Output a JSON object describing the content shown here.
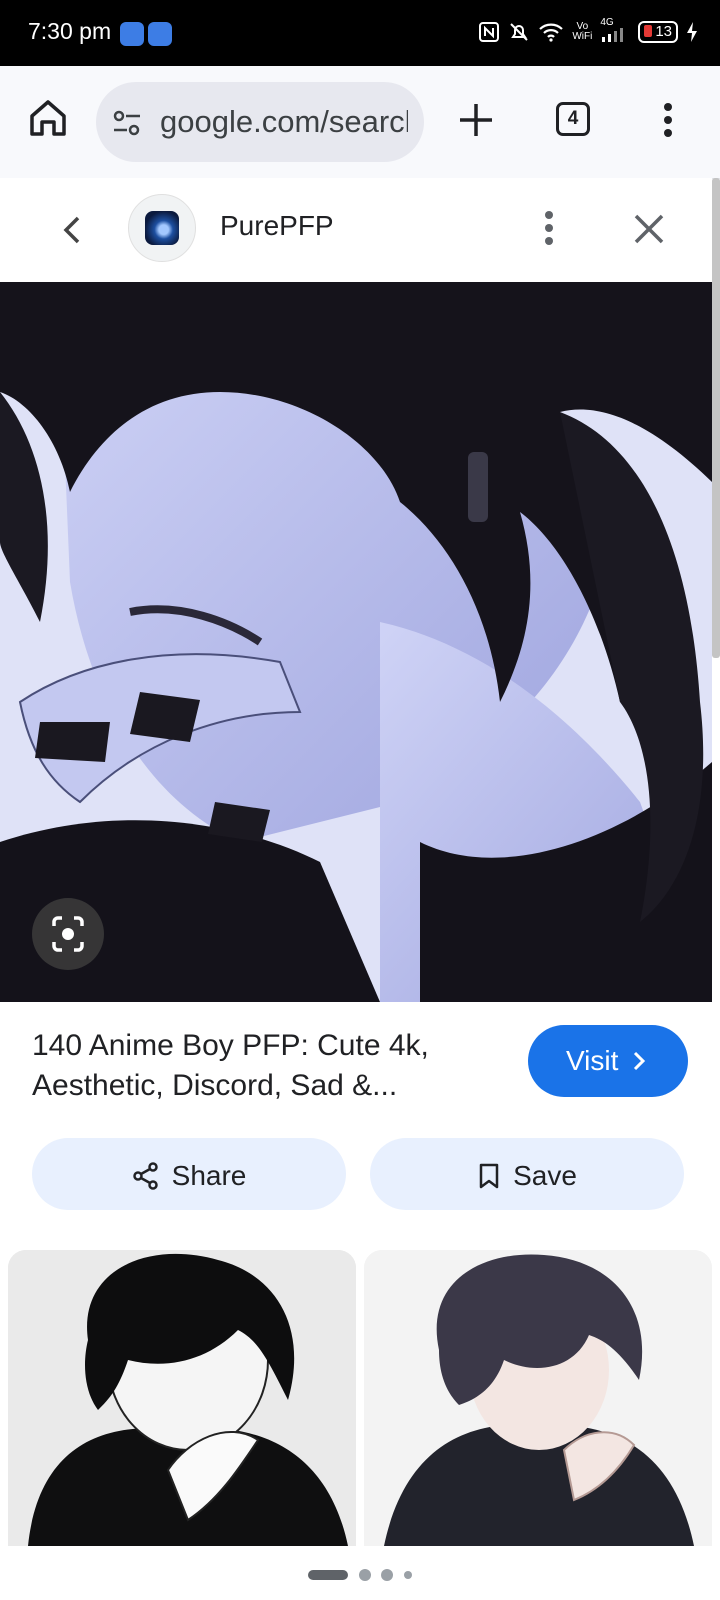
{
  "status_bar": {
    "time": "7:30 pm",
    "vowifi_top": "Vo",
    "vowifi_bottom": "WiFi",
    "network": "4G",
    "battery": "13"
  },
  "browser": {
    "url": "google.com/search",
    "tab_count": "4"
  },
  "source": {
    "site_name": "PurePFP"
  },
  "result": {
    "title": "140 Anime Boy PFP: Cute 4k, Aesthetic, Discord, Sad &...",
    "visit_label": "Visit",
    "share_label": "Share",
    "save_label": "Save"
  },
  "related_images": [
    {
      "name": "related-image-1"
    },
    {
      "name": "related-image-2"
    }
  ],
  "pager": {
    "total": 4,
    "active": 1
  },
  "colors": {
    "accent": "#1a73e8",
    "pill_bg": "#e8f0fe",
    "toolbar_bg": "#f8f9fc",
    "url_bg": "#e7e8ef"
  },
  "icons": {
    "home": "home-icon",
    "tune": "tune-icon",
    "new_tab": "plus-icon",
    "menu": "more-vert-icon",
    "back": "chevron-left-icon",
    "close": "close-icon",
    "lens": "lens-icon",
    "share": "share-icon",
    "save": "bookmark-icon"
  }
}
